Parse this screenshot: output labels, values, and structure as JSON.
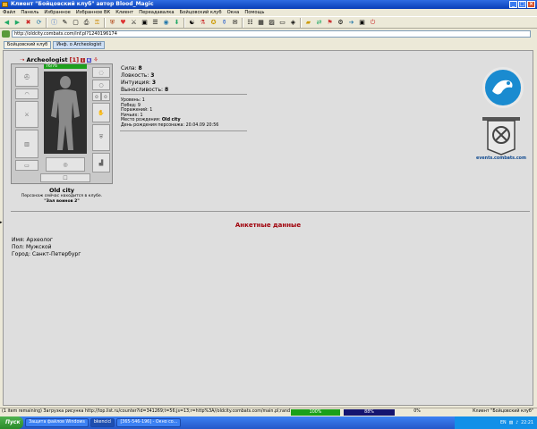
{
  "window": {
    "title": "Клиент \"Бойцовский клуб\" автор Blood_Magic"
  },
  "menu": [
    "Файл",
    "Панель",
    "Избранное",
    "Избранное ВК",
    "Клиент",
    "Переадавалка",
    "Бойцовский клуб",
    "Окна",
    "Помощь"
  ],
  "address": {
    "url": "http://oldcity.combats.com/inf.pl?1240196174"
  },
  "tabs": [
    {
      "label": "Бойцовский клуб"
    },
    {
      "label": "Инф. о Archeologist"
    }
  ],
  "character": {
    "name": "Archeologist",
    "level": "[1]",
    "hp": "76/76",
    "location": "Old city",
    "status_line": "Персонаж сейчас находится в клубе.",
    "room": "\"Зал воинов 2\""
  },
  "stats": {
    "strength_label": "Сила:",
    "strength": "8",
    "agility_label": "Ловкость:",
    "agility": "3",
    "intuition_label": "Интуиция:",
    "intuition": "3",
    "endurance_label": "Выносливость:",
    "endurance": "8"
  },
  "info": {
    "ups": "Уровень: 1",
    "wins": "Побед: 9",
    "losses": "Поражений: 1",
    "draws": "Ничьих: 1",
    "birthplace_label": "Место рождения:",
    "birthplace": "Old city",
    "birthday": "День рождения персонажа: 20.04.09 20:56"
  },
  "events_link": "events.combats.com",
  "profile": {
    "heading": "Анкетные данные",
    "name": "Имя: Археолог",
    "gender": "Пол: Мужской",
    "city": "Город: Санкт-Петербург"
  },
  "statusbar": {
    "text": "(1 item remaining) Загрузка рисунка http://top.list.ru/counter?id=341269;t=56;js=13;r=http%3A//oldcity.combats.com/main.pl;rand",
    "progress1": "100%",
    "progress2": "88%",
    "progress3": "0%",
    "client": "Клиент \"Бойцовский клуб\""
  },
  "taskbar": {
    "start": "Пуск",
    "items": [
      "Защита файлов Windows",
      "bkencicl",
      "[365-546-196] - Окно со..."
    ],
    "lang": "EN",
    "clock": "22:21"
  },
  "colors": {
    "title_blue": "#0a3fb8",
    "hp_green": "#1da11d",
    "heading_red": "#a0000a",
    "link_blue": "#104a90"
  }
}
